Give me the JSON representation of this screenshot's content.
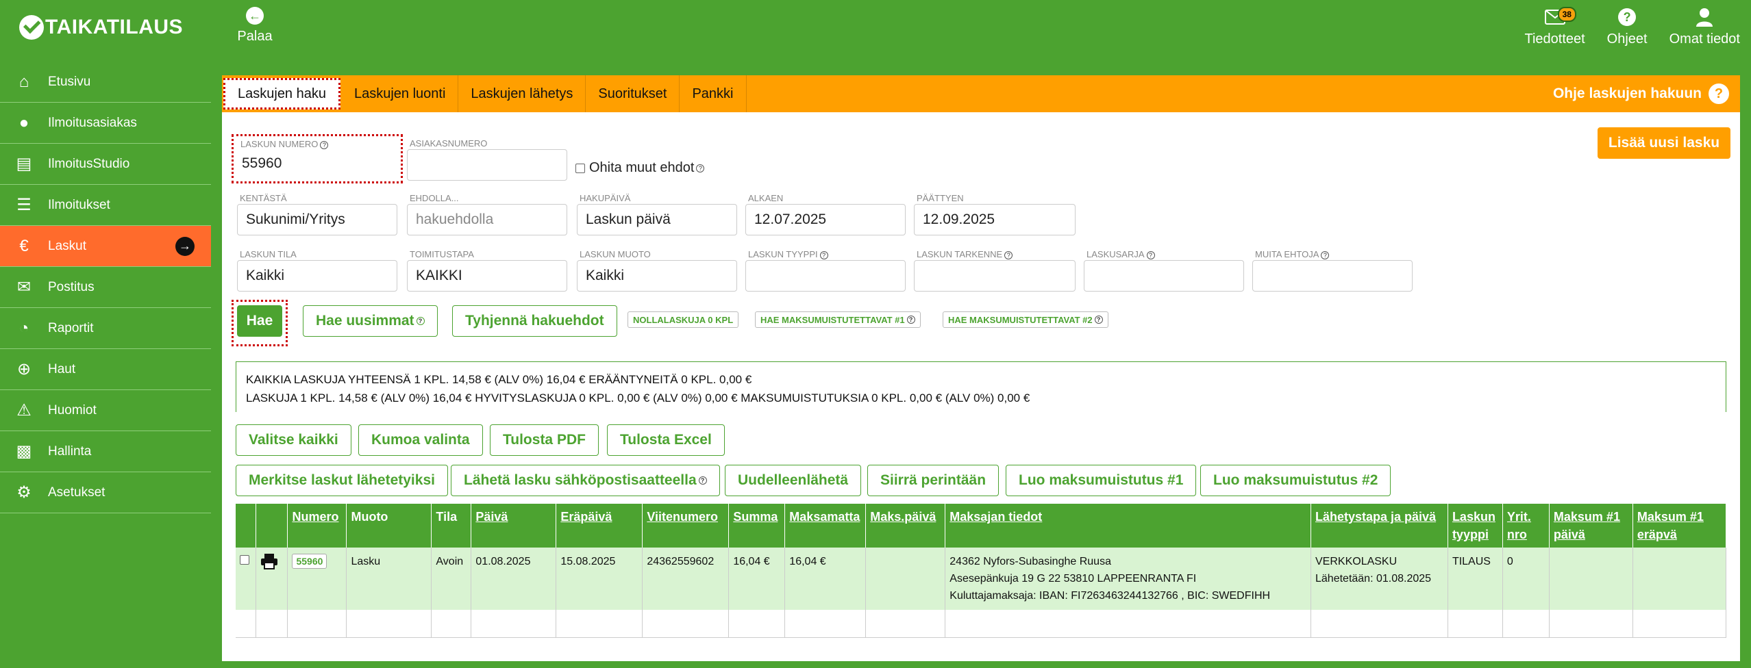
{
  "brand": {
    "name": "TAIKATILAUS"
  },
  "topbar": {
    "back_label": "Palaa",
    "items": [
      {
        "label": "Tiedotteet",
        "badge": "38"
      },
      {
        "label": "Ohjeet"
      },
      {
        "label": "Omat tiedot"
      }
    ]
  },
  "sidebar": {
    "items": [
      {
        "label": "Etusivu"
      },
      {
        "label": "Ilmoitusasiakas"
      },
      {
        "label": "IlmoitusStudio"
      },
      {
        "label": "Ilmoitukset"
      },
      {
        "label": "Laskut"
      },
      {
        "label": "Postitus"
      },
      {
        "label": "Raportit"
      },
      {
        "label": "Haut"
      },
      {
        "label": "Huomiot"
      },
      {
        "label": "Hallinta"
      },
      {
        "label": "Asetukset"
      }
    ]
  },
  "tabs": {
    "items": [
      "Laskujen haku",
      "Laskujen luonti",
      "Laskujen lähetys",
      "Suoritukset",
      "Pankki"
    ],
    "help": "Ohje laskujen hakuun"
  },
  "form": {
    "laskun_numero": {
      "label": "LASKUN NUMERO",
      "value": "55960"
    },
    "asiakasnumero": {
      "label": "ASIAKASNUMERO",
      "value": ""
    },
    "ohita": "Ohita muut ehdot",
    "kentasta": {
      "label": "KENTÄSTÄ",
      "value": "Sukunimi/Yritys"
    },
    "ehdolla": {
      "label": "EHDOLLA...",
      "placeholder": "hakuehdolla"
    },
    "hakupaiva": {
      "label": "HAKUPÄIVÄ",
      "value": "Laskun päivä"
    },
    "alkaen": {
      "label": "ALKAEN",
      "value": "12.07.2025"
    },
    "paattyen": {
      "label": "PÄÄTTYEN",
      "value": "12.09.2025"
    },
    "laskun_tila": {
      "label": "LASKUN TILA",
      "value": "Kaikki"
    },
    "toimitustapa": {
      "label": "TOIMITUSTAPA",
      "value": "KAIKKI"
    },
    "laskun_muoto": {
      "label": "LASKUN MUOTO",
      "value": "Kaikki"
    },
    "laskun_tyyppi": {
      "label": "LASKUN TYYPPI",
      "value": ""
    },
    "laskun_tarkenne": {
      "label": "LASKUN TARKENNE",
      "value": ""
    },
    "laskusarja": {
      "label": "LASKUSARJA",
      "value": ""
    },
    "muita_ehtoja": {
      "label": "MUITA EHTOJA",
      "value": ""
    }
  },
  "actions": {
    "add_new": "Lisää uusi lasku",
    "hae": "Hae",
    "hae_uusimmat": "Hae uusimmat",
    "tyhjenna": "Tyhjennä hakuehdot",
    "tag_nolla": "NOLLALASKUJA 0 KPL",
    "tag_m1": "HAE MAKSUMUISTUTETTAVAT #1",
    "tag_m2": "HAE MAKSUMUISTUTETTAVAT #2"
  },
  "summary": {
    "line1": "KAIKKIA LASKUJA YHTEENSÄ 1 KPL. 14,58 € (ALV 0%)  16,04 € ERÄÄNTYNEITÄ 0 KPL. 0,00 €",
    "line2": "LASKUJA 1 KPL. 14,58 € (ALV 0%)  16,04 €   HYVITYSLASKUJA 0 KPL. 0,00 € (ALV 0%)  0,00 €    MAKSUMUISTUTUKSIA 0 KPL. 0,00 € (ALV 0%)  0,00 €"
  },
  "buttons_row1": [
    "Valitse kaikki",
    "Kumoa valinta",
    "Tulosta PDF",
    "Tulosta Excel"
  ],
  "buttons_row2": [
    "Merkitse laskut lähetetyiksi",
    "Lähetä lasku sähköpostisaatteella",
    "Uudelleenlähetä",
    "Siirrä perintään",
    "Luo maksumuistutus #1",
    "Luo maksumuistutus #2"
  ],
  "table": {
    "headers": [
      "Numero",
      "Muoto",
      "Tila",
      "Päivä",
      "Eräpäivä",
      "Viitenumero",
      "Summa",
      "Maksamatta",
      "Maks.päivä",
      "Maksajan tiedot",
      "Lähetystapa ja päivä",
      "Laskun tyyppi",
      "Yrit. nro",
      "Maksum #1 päivä",
      "Maksum #1 eräpvä"
    ],
    "row": {
      "numero": "55960",
      "muoto": "Lasku",
      "tila": "Avoin",
      "paiva": "01.08.2025",
      "erapaiva": "15.08.2025",
      "viite": "24362559602",
      "summa": "16,04 €",
      "maksamatta": "16,04 €",
      "maksupaiva": "",
      "maksaja1": "24362 Nyfors-Subasinghe Ruusa",
      "maksaja2": "Asesepänkuja 19 G 22 53810 LAPPEENRANTA FI",
      "maksaja3": "Kuluttajamaksaja: IBAN: FI7263463244132766 , BIC: SWEDFIHH",
      "lahetys1": "VERKKOLASKU",
      "lahetys2": "Lähetetään: 01.08.2025",
      "tyyppi": "TILAUS",
      "yrit": "0"
    }
  },
  "colors": {
    "green": "#4ca330",
    "orange": "#ff9f00",
    "active": "#ff6b2c",
    "row": "#d9f3d2"
  }
}
